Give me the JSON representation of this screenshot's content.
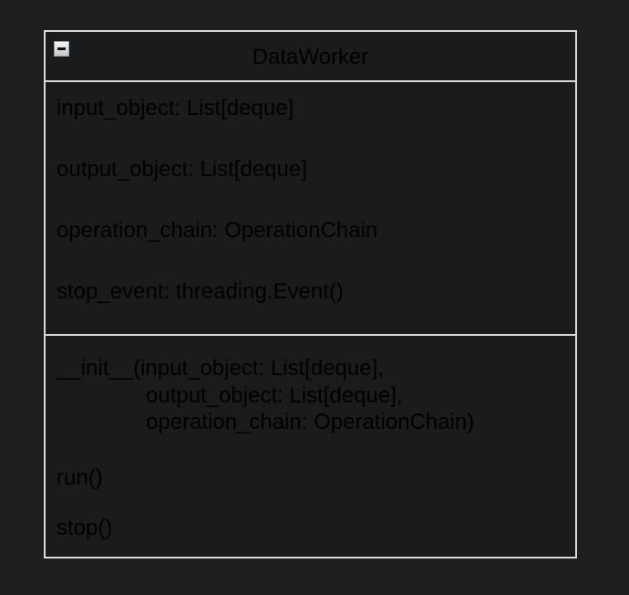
{
  "class": {
    "name": "DataWorker",
    "attributes": [
      "input_object: List[deque]",
      "output_object: List[deque]",
      "operation_chain: OperationChain",
      "stop_event: threading.Event()"
    ],
    "methods": {
      "init_line1": "__init__(input_object: List[deque],",
      "init_line2": "output_object: List[deque],",
      "init_line3": "operation_chain: OperationChain)",
      "run": "run()",
      "stop": "stop()"
    }
  }
}
